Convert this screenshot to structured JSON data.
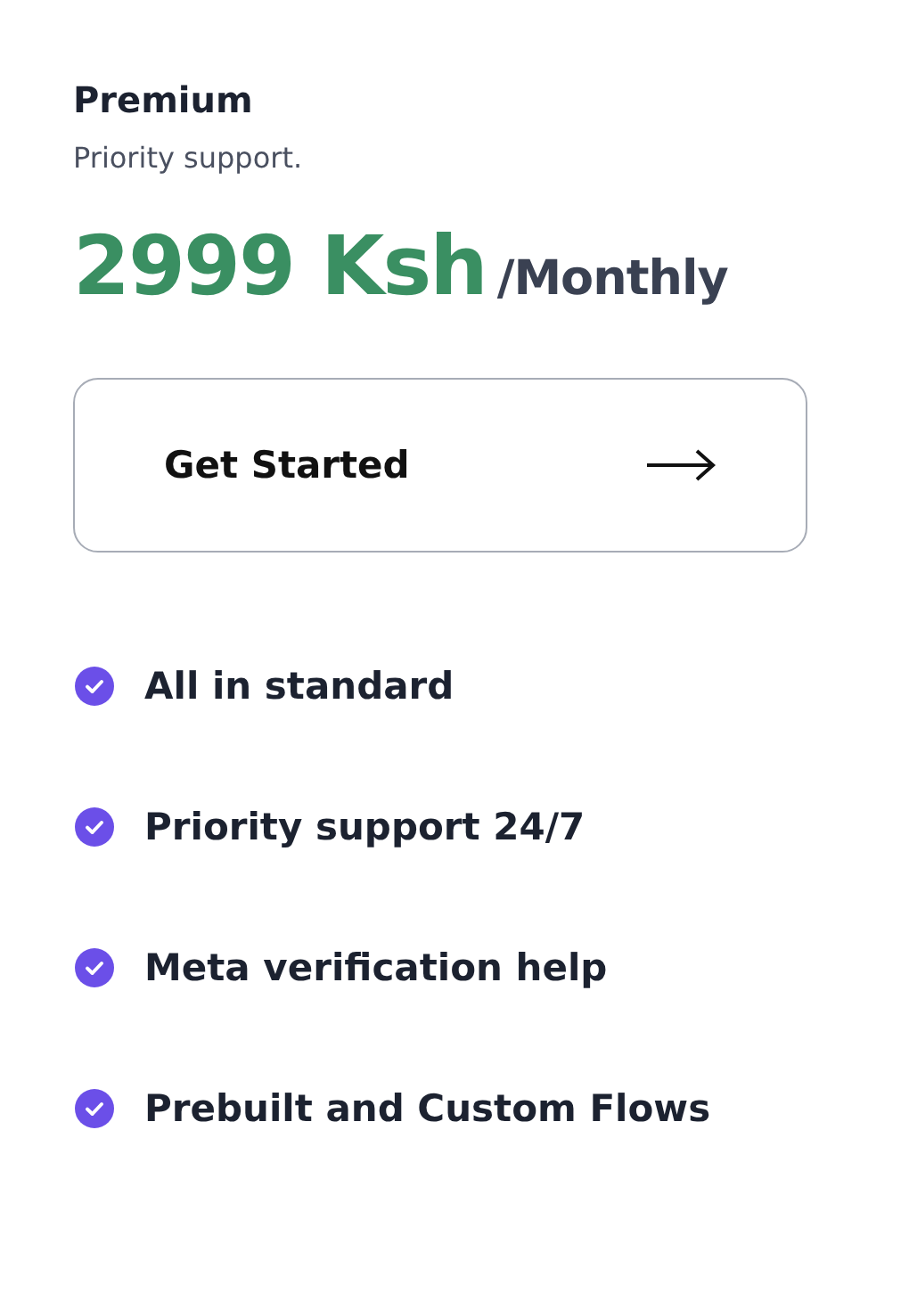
{
  "plan": {
    "name": "Premium",
    "description": "Priority support.",
    "price": "2999 Ksh",
    "period": "/Monthly"
  },
  "button": {
    "label": "Get Started"
  },
  "features": [
    {
      "label": "All in standard"
    },
    {
      "label": "Priority support 24/7"
    },
    {
      "label": "Meta verification help"
    },
    {
      "label": "Prebuilt and Custom Flows"
    }
  ]
}
